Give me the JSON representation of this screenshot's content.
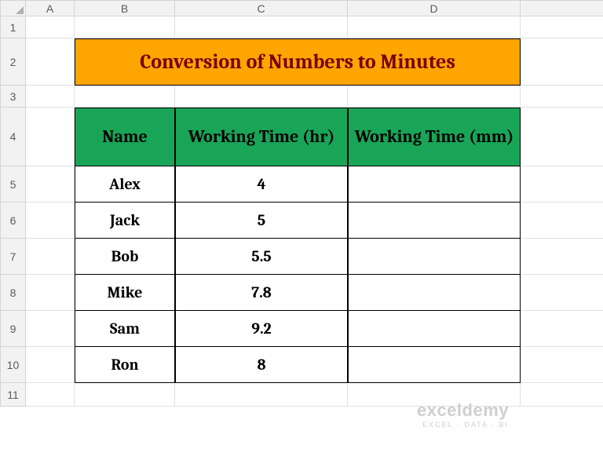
{
  "columns": [
    "A",
    "B",
    "C",
    "D"
  ],
  "rows": [
    "1",
    "2",
    "3",
    "4",
    "5",
    "6",
    "7",
    "8",
    "9",
    "10",
    "11"
  ],
  "title": "Conversion of Numbers to Minutes",
  "headers": {
    "name": "Name",
    "hr": "Working Time (hr)",
    "mm": "Working Time (mm)"
  },
  "data": [
    {
      "name": "Alex",
      "hr": "4",
      "mm": ""
    },
    {
      "name": "Jack",
      "hr": "5",
      "mm": ""
    },
    {
      "name": "Bob",
      "hr": "5.5",
      "mm": ""
    },
    {
      "name": "Mike",
      "hr": "7.8",
      "mm": ""
    },
    {
      "name": "Sam",
      "hr": "9.2",
      "mm": ""
    },
    {
      "name": "Ron",
      "hr": "8",
      "mm": ""
    }
  ],
  "watermark": {
    "brand": "exceldemy",
    "tagline": "EXCEL · DATA · BI"
  },
  "chart_data": {
    "type": "table",
    "title": "Conversion of Numbers to Minutes",
    "columns": [
      "Name",
      "Working Time (hr)",
      "Working Time (mm)"
    ],
    "rows": [
      [
        "Alex",
        4,
        null
      ],
      [
        "Jack",
        5,
        null
      ],
      [
        "Bob",
        5.5,
        null
      ],
      [
        "Mike",
        7.8,
        null
      ],
      [
        "Sam",
        9.2,
        null
      ],
      [
        "Ron",
        8,
        null
      ]
    ]
  }
}
